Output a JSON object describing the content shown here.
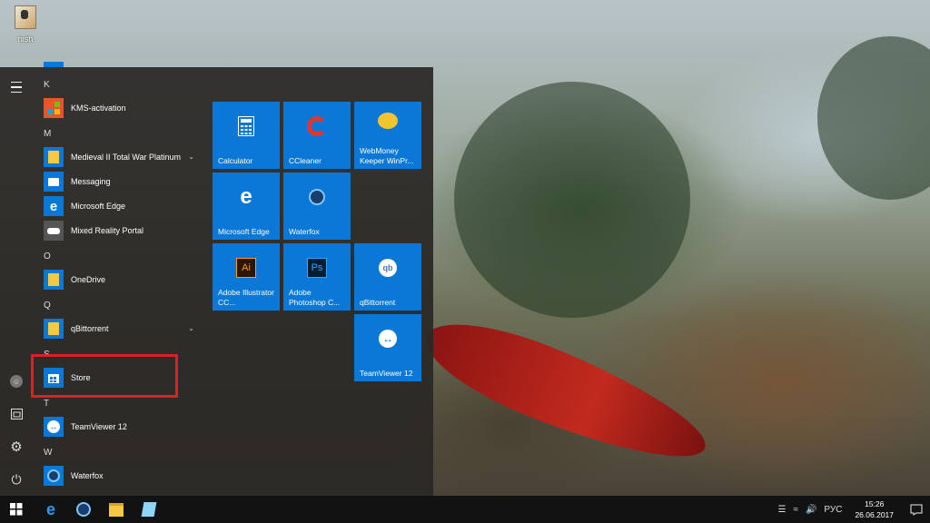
{
  "desktop": {
    "icons": [
      {
        "label": "nish",
        "icon": "user-image-icon"
      }
    ]
  },
  "start_menu": {
    "rail": {
      "menu_icon": "hamburger-icon",
      "user_icon": "user-avatar-icon",
      "documents_icon": "documents-icon",
      "settings_icon": "gear-icon",
      "power_icon": "power-icon"
    },
    "app_list": {
      "sections": [
        {
          "letter": "K",
          "apps": [
            {
              "label": "KMS-activation",
              "icon": "kms-icon",
              "color": "#e4572e"
            }
          ]
        },
        {
          "letter": "M",
          "apps": [
            {
              "label": "Medieval II Total War Platinum",
              "icon": "folder-icon",
              "color": "#f6c945",
              "expandable": true
            },
            {
              "label": "Messaging",
              "icon": "message-icon",
              "color": "#0b78d7"
            },
            {
              "label": "Microsoft Edge",
              "icon": "edge-icon",
              "color": "#0b78d7"
            },
            {
              "label": "Mixed Reality Portal",
              "icon": "vr-headset-icon",
              "color": "#555555"
            }
          ]
        },
        {
          "letter": "O",
          "apps": [
            {
              "label": "OneDrive",
              "icon": "folder-icon",
              "color": "#f6c945"
            }
          ]
        },
        {
          "letter": "Q",
          "apps": [
            {
              "label": "qBittorrent",
              "icon": "folder-icon",
              "color": "#f6c945",
              "expandable": true
            }
          ]
        },
        {
          "letter": "S",
          "apps": [
            {
              "label": "Store",
              "icon": "store-icon",
              "color": "#0b78d7"
            }
          ]
        },
        {
          "letter": "T",
          "apps": [
            {
              "label": "TeamViewer 12",
              "icon": "teamviewer-icon",
              "color": "#0b78d7"
            }
          ]
        },
        {
          "letter": "W",
          "apps": [
            {
              "label": "Waterfox",
              "icon": "waterfox-icon",
              "color": "#0b78d7"
            }
          ]
        }
      ]
    },
    "tiles": [
      {
        "label": "Calculator",
        "icon": "calculator-icon"
      },
      {
        "label": "CCleaner",
        "icon": "ccleaner-icon"
      },
      {
        "label": "WebMoney Keeper WinPr...",
        "icon": "webmoney-icon"
      },
      {
        "label": "Microsoft Edge",
        "icon": "edge-icon"
      },
      {
        "label": "Waterfox",
        "icon": "waterfox-icon"
      },
      {
        "label": "Adobe Illustrator CC...",
        "icon": "illustrator-icon"
      },
      {
        "label": "Adobe Photoshop C...",
        "icon": "photoshop-icon"
      },
      {
        "label": "qBittorrent",
        "icon": "qbittorrent-icon"
      },
      {
        "label": "TeamViewer 12",
        "icon": "teamviewer-icon"
      }
    ]
  },
  "taskbar": {
    "start_icon": "windows-start-icon",
    "pinned": [
      "edge-icon",
      "waterfox-icon",
      "file-explorer-icon",
      "notepad-icon"
    ],
    "tray": {
      "language": "РУС",
      "time": "15:26",
      "date": "26.06.2017"
    }
  },
  "colors": {
    "tile_blue": "#0b78d7",
    "highlight_red": "#e02020",
    "menu_bg": "#2a2826"
  }
}
